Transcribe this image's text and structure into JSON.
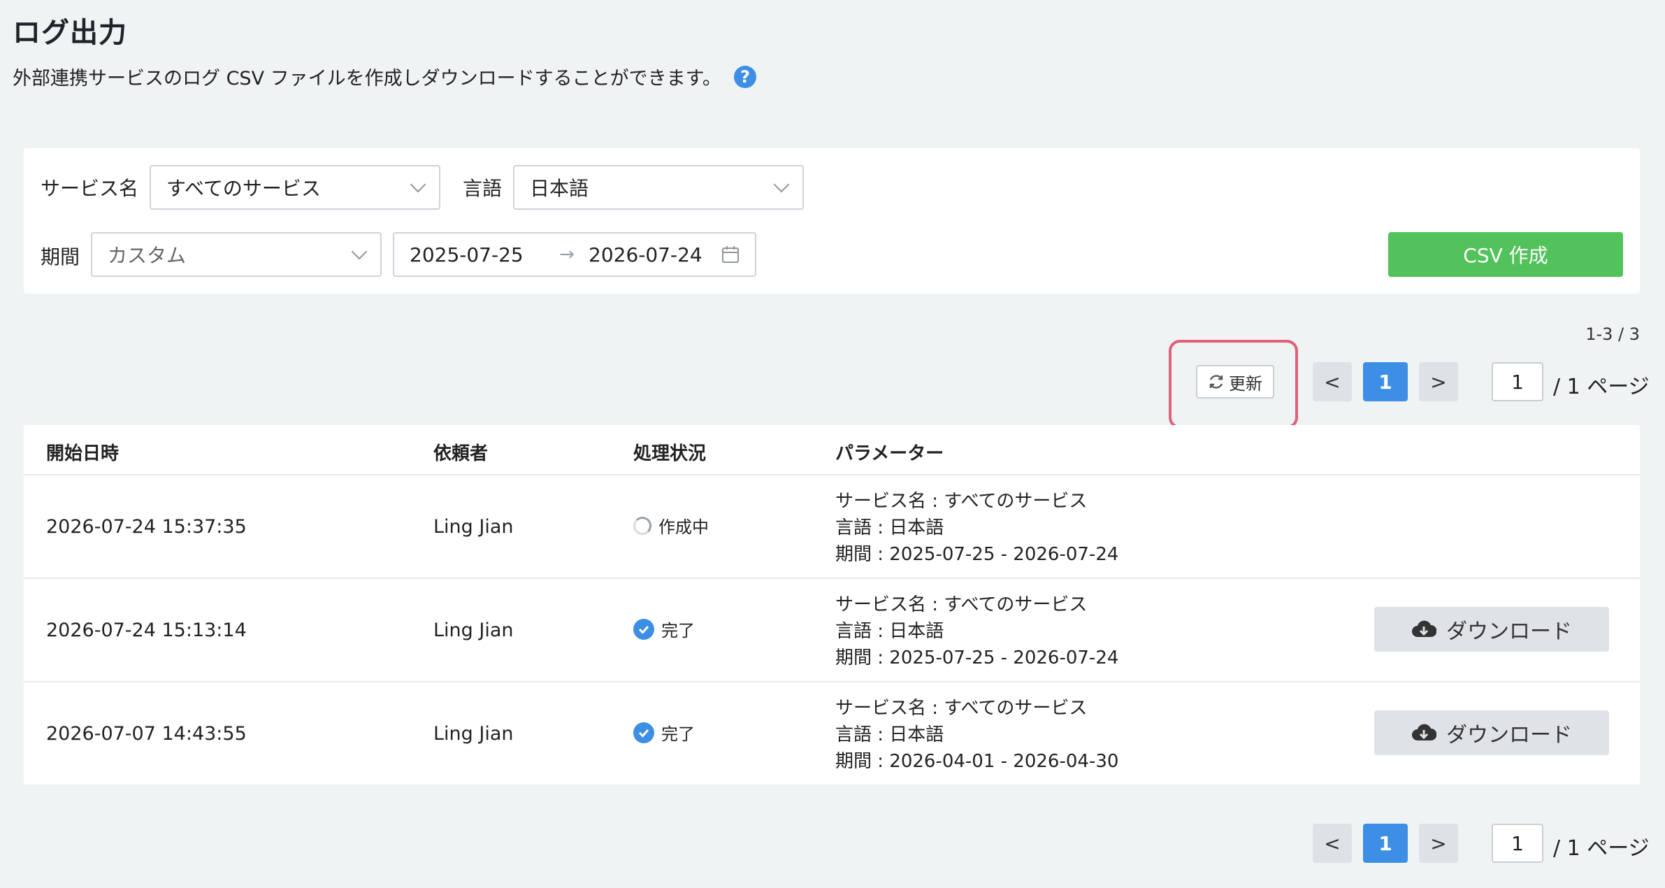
{
  "page": {
    "title": "ログ出力",
    "description": "外部連携サービスのログ CSV ファイルを作成しダウンロードすることができます。",
    "help_icon": "question-circle-icon"
  },
  "filters": {
    "service_label": "サービス名",
    "service_value": "すべてのサービス",
    "language_label": "言語",
    "language_value": "日本語",
    "period_label": "期間",
    "period_value": "カスタム",
    "date_start": "2025-07-25",
    "date_arrow": "→",
    "date_end": "2026-07-24",
    "csv_button": "CSV 作成"
  },
  "pagination": {
    "range": "1-3 / 3",
    "refresh_label": "更新",
    "prev": "<",
    "next": ">",
    "current_page": "1",
    "page_input": "1",
    "total_label": "/ 1 ページ"
  },
  "table": {
    "headers": {
      "date": "開始日時",
      "requester": "依頼者",
      "status": "処理状況",
      "params": "パラメーター"
    },
    "rows": [
      {
        "date": "2026-07-24 15:37:35",
        "requester": "Ling Jian",
        "status": "作成中",
        "param_service": "サービス名 : すべてのサービス",
        "param_language": "言語 : 日本語",
        "param_period": "期間 : 2025-07-25 - 2026-07-24"
      },
      {
        "date": "2026-07-24 15:13:14",
        "requester": "Ling Jian",
        "status": "完了",
        "param_service": "サービス名 : すべてのサービス",
        "param_language": "言語 : 日本語",
        "param_period": "期間 : 2025-07-25 - 2026-07-24",
        "download_label": "ダウンロード"
      },
      {
        "date": "2026-07-07 14:43:55",
        "requester": "Ling Jian",
        "status": "完了",
        "param_service": "サービス名 : すべてのサービス",
        "param_language": "言語 : 日本語",
        "param_period": "期間 : 2026-04-01 - 2026-04-30",
        "download_label": "ダウンロード"
      }
    ]
  },
  "colors": {
    "accent": "#3d8fe6",
    "success": "#52c25a",
    "highlight": "#e0607a"
  }
}
